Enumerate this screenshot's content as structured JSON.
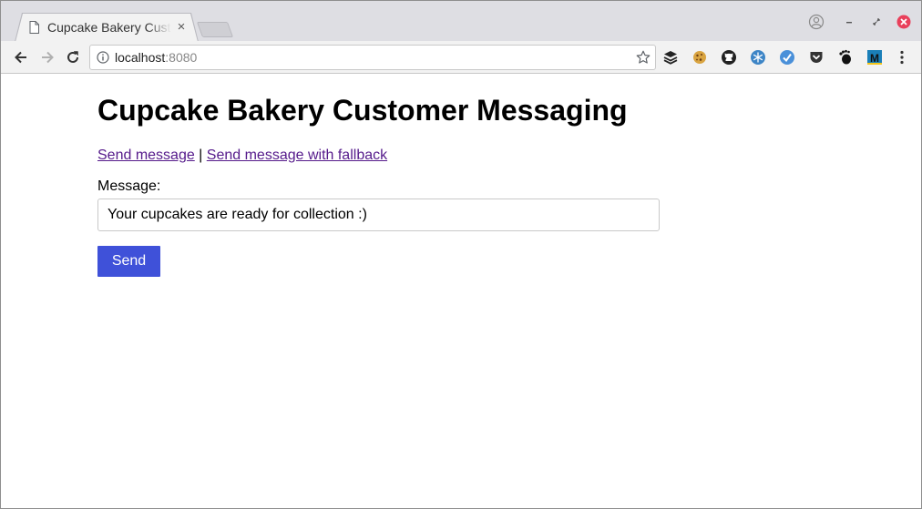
{
  "browser": {
    "tab": {
      "title": "Cupcake Bakery Customer Messaging",
      "close_glyph": "×",
      "icon": "document-icon"
    },
    "address_bar": {
      "host": "localhost",
      "port": ":8080",
      "icon": "info-icon"
    },
    "toolbar_icons": [
      "back-arrow-icon",
      "forward-arrow-icon",
      "reload-icon",
      "bookmark-star-icon"
    ],
    "extension_icons": [
      "layers-icon",
      "cookie-icon",
      "github-icon",
      "snowflake-icon",
      "checkmark-badge-icon",
      "pocket-icon",
      "gnome-foot-icon",
      "m-badge-icon",
      "kebab-menu-icon"
    ],
    "window_controls": [
      "profile-icon",
      "minimize-icon",
      "restore-icon",
      "close-icon"
    ],
    "colors": {
      "tabstrip": "#dedee3",
      "toolbar": "#f2f2f2",
      "close_button": "#e9405b"
    }
  },
  "page": {
    "title": "Cupcake Bakery Customer Messaging",
    "links": {
      "send_message": "Send message",
      "separator": " | ",
      "send_with_fallback": "Send message with fallback"
    },
    "form": {
      "message_label": "Message:",
      "message_value": "Your cupcakes are ready for collection :)",
      "send_label": "Send"
    },
    "colors": {
      "link_visited": "#551a8b",
      "button_bg": "#3f51d9",
      "button_text": "#ffffff"
    }
  }
}
